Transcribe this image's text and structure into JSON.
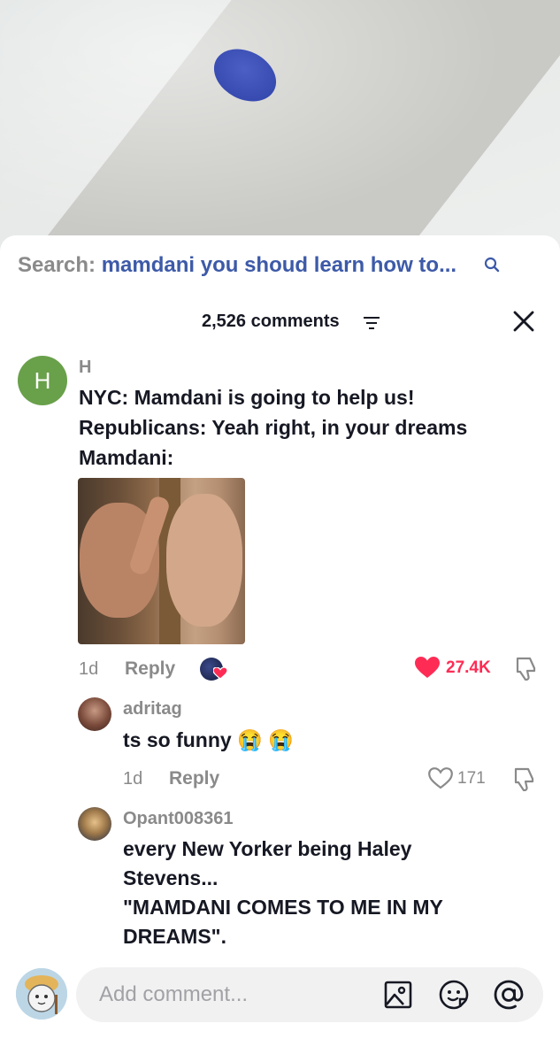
{
  "search": {
    "prefix": "Search:",
    "query": "mamdani you shoud learn how to..."
  },
  "comments_header": {
    "count_label": "2,526 comments"
  },
  "comments": [
    {
      "avatar_letter": "H",
      "username": "H",
      "text_lines": [
        "NYC: Mamdani is going to help us!",
        "Republicans: Yeah right, in your dreams",
        "Mamdani:"
      ],
      "age": "1d",
      "reply_label": "Reply",
      "likes": "27.4K"
    },
    {
      "username": "adritag",
      "text": "ts so funny 😭 😭",
      "age": "1d",
      "reply_label": "Reply",
      "likes": "171"
    },
    {
      "username": "Opant008361",
      "text_lines": [
        "every New Yorker being Haley",
        "Stevens...",
        "\"MAMDANI COMES TO ME IN MY",
        "DREAMS\"."
      ]
    }
  ],
  "composer": {
    "placeholder": "Add comment..."
  },
  "colors": {
    "accent_blue": "#3d5aa8",
    "like_red": "#fe2c55",
    "avatar_green": "#69a04a"
  },
  "icons": [
    "search-icon",
    "filter-icon",
    "close-icon",
    "heart-icon",
    "dislike-icon",
    "image-icon",
    "emoji-icon",
    "mention-icon"
  ]
}
